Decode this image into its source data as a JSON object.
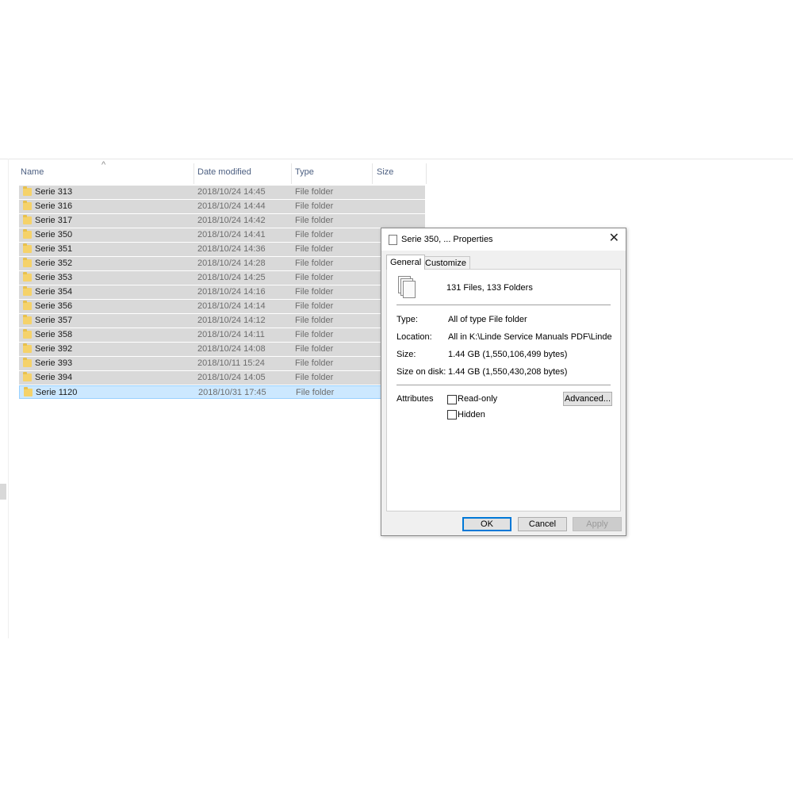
{
  "explorer": {
    "columns": {
      "name": "Name",
      "date_modified": "Date modified",
      "type": "Type",
      "size": "Size"
    },
    "sort_indicator": "^",
    "rows": [
      {
        "name": "Serie 313",
        "date": "2018/10/24 14:45",
        "type": "File folder"
      },
      {
        "name": "Serie 316",
        "date": "2018/10/24 14:44",
        "type": "File folder"
      },
      {
        "name": "Serie 317",
        "date": "2018/10/24 14:42",
        "type": "File folder"
      },
      {
        "name": "Serie 350",
        "date": "2018/10/24 14:41",
        "type": "File folder"
      },
      {
        "name": "Serie 351",
        "date": "2018/10/24 14:36",
        "type": "File folder"
      },
      {
        "name": "Serie 352",
        "date": "2018/10/24 14:28",
        "type": "File folder"
      },
      {
        "name": "Serie 353",
        "date": "2018/10/24 14:25",
        "type": "File folder"
      },
      {
        "name": "Serie 354",
        "date": "2018/10/24 14:16",
        "type": "File folder"
      },
      {
        "name": "Serie 356",
        "date": "2018/10/24 14:14",
        "type": "File folder"
      },
      {
        "name": "Serie 357",
        "date": "2018/10/24 14:12",
        "type": "File folder"
      },
      {
        "name": "Serie 358",
        "date": "2018/10/24 14:11",
        "type": "File folder"
      },
      {
        "name": "Serie 392",
        "date": "2018/10/24 14:08",
        "type": "File folder"
      },
      {
        "name": "Serie 393",
        "date": "2018/10/11 15:24",
        "type": "File folder"
      },
      {
        "name": "Serie 394",
        "date": "2018/10/24 14:05",
        "type": "File folder"
      },
      {
        "name": "Serie 1120",
        "date": "2018/10/31 17:45",
        "type": "File folder"
      }
    ]
  },
  "dialog": {
    "title": "Serie 350, ... Properties",
    "close_glyph": "✕",
    "tabs": [
      "General",
      "Customize"
    ],
    "summary": "131 Files, 133 Folders",
    "type_label": "Type:",
    "type_value": "All of type File folder",
    "location_label": "Location:",
    "location_value": "All in K:\\Linde Service Manuals PDF\\Linde Service M",
    "size_label": "Size:",
    "size_value": "1.44 GB (1,550,106,499 bytes)",
    "size_on_disk_label": "Size on disk:",
    "size_on_disk_value": "1.44 GB (1,550,430,208 bytes)",
    "attributes_label": "Attributes",
    "readonly_label": "Read-only",
    "hidden_label": "Hidden",
    "advanced_label": "Advanced...",
    "ok_label": "OK",
    "cancel_label": "Cancel",
    "apply_label": "Apply"
  }
}
